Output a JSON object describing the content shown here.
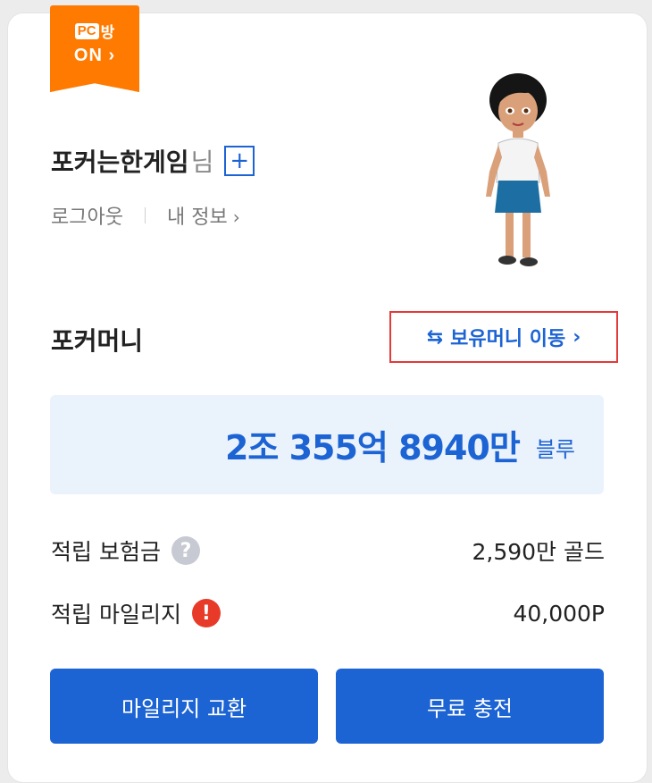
{
  "badge": {
    "pc": "PC",
    "bang": "방",
    "status": "ON"
  },
  "profile": {
    "nickname": "포커는한게임",
    "suffix": "님",
    "logout": "로그아웃",
    "myinfo": "내 정보"
  },
  "money": {
    "title": "포커머니",
    "transfer_label": "보유머니 이동",
    "balance": "2조 355억 8940만",
    "unit": "블루"
  },
  "stats": [
    {
      "label": "적립 보험금",
      "value": "2,590만 골드"
    },
    {
      "label": "적립 마일리지",
      "value": "40,000P"
    }
  ],
  "buttons": {
    "exchange": "마일리지 교환",
    "charge": "무료 충전"
  },
  "colors": {
    "primary": "#1c63d4",
    "badge": "#ff7a00",
    "highlight": "#e43a3a"
  }
}
